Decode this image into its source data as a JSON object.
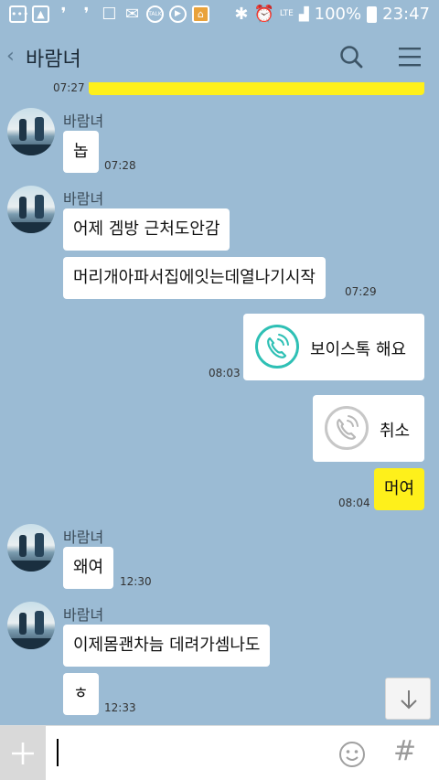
{
  "status_bar": {
    "network": "LTE",
    "battery": "100%",
    "clock": "23:47",
    "icons": [
      "chat-bubble-icon",
      "image-icon",
      "notification-icon",
      "notification-icon",
      "phone-icon",
      "mail-icon",
      "talk-icon",
      "youtube-icon",
      "app-icon",
      "bluetooth-icon",
      "alarm-icon",
      "signal-icon",
      "battery-icon"
    ],
    "talk_label": "TALK"
  },
  "header": {
    "title": "바람녀",
    "back_icon": "chevron-left-icon",
    "search_icon": "search-icon",
    "menu_icon": "menu-icon"
  },
  "messages": {
    "partial_time": "07:27",
    "m1": {
      "sender": "바람녀",
      "text": "놉",
      "time": "07:28"
    },
    "m2": {
      "sender": "바람녀",
      "text1": "어제 겜방 근처도안감",
      "text2": "머리개아파서집에잇는데열나기시작",
      "time": "07:29"
    },
    "m3": {
      "label": "보이스톡 해요",
      "time": "08:03",
      "icon": "phone-call-icon"
    },
    "m4": {
      "label": "취소",
      "icon": "phone-call-icon"
    },
    "m5": {
      "text": "머여",
      "time": "08:04"
    },
    "m6": {
      "sender": "바람녀",
      "text": "왜여",
      "time": "12:30"
    },
    "m7": {
      "sender": "바람녀",
      "text1": "이제몸괜차늠 데려가셈나도",
      "text2": "ㅎ",
      "time": "12:33"
    }
  },
  "input": {
    "value": "",
    "placeholder": ""
  },
  "colors": {
    "background": "#9bbbd4",
    "my_bubble": "#fef01b",
    "their_bubble": "#ffffff",
    "voicetalk_accent": "#2fc0b5"
  }
}
